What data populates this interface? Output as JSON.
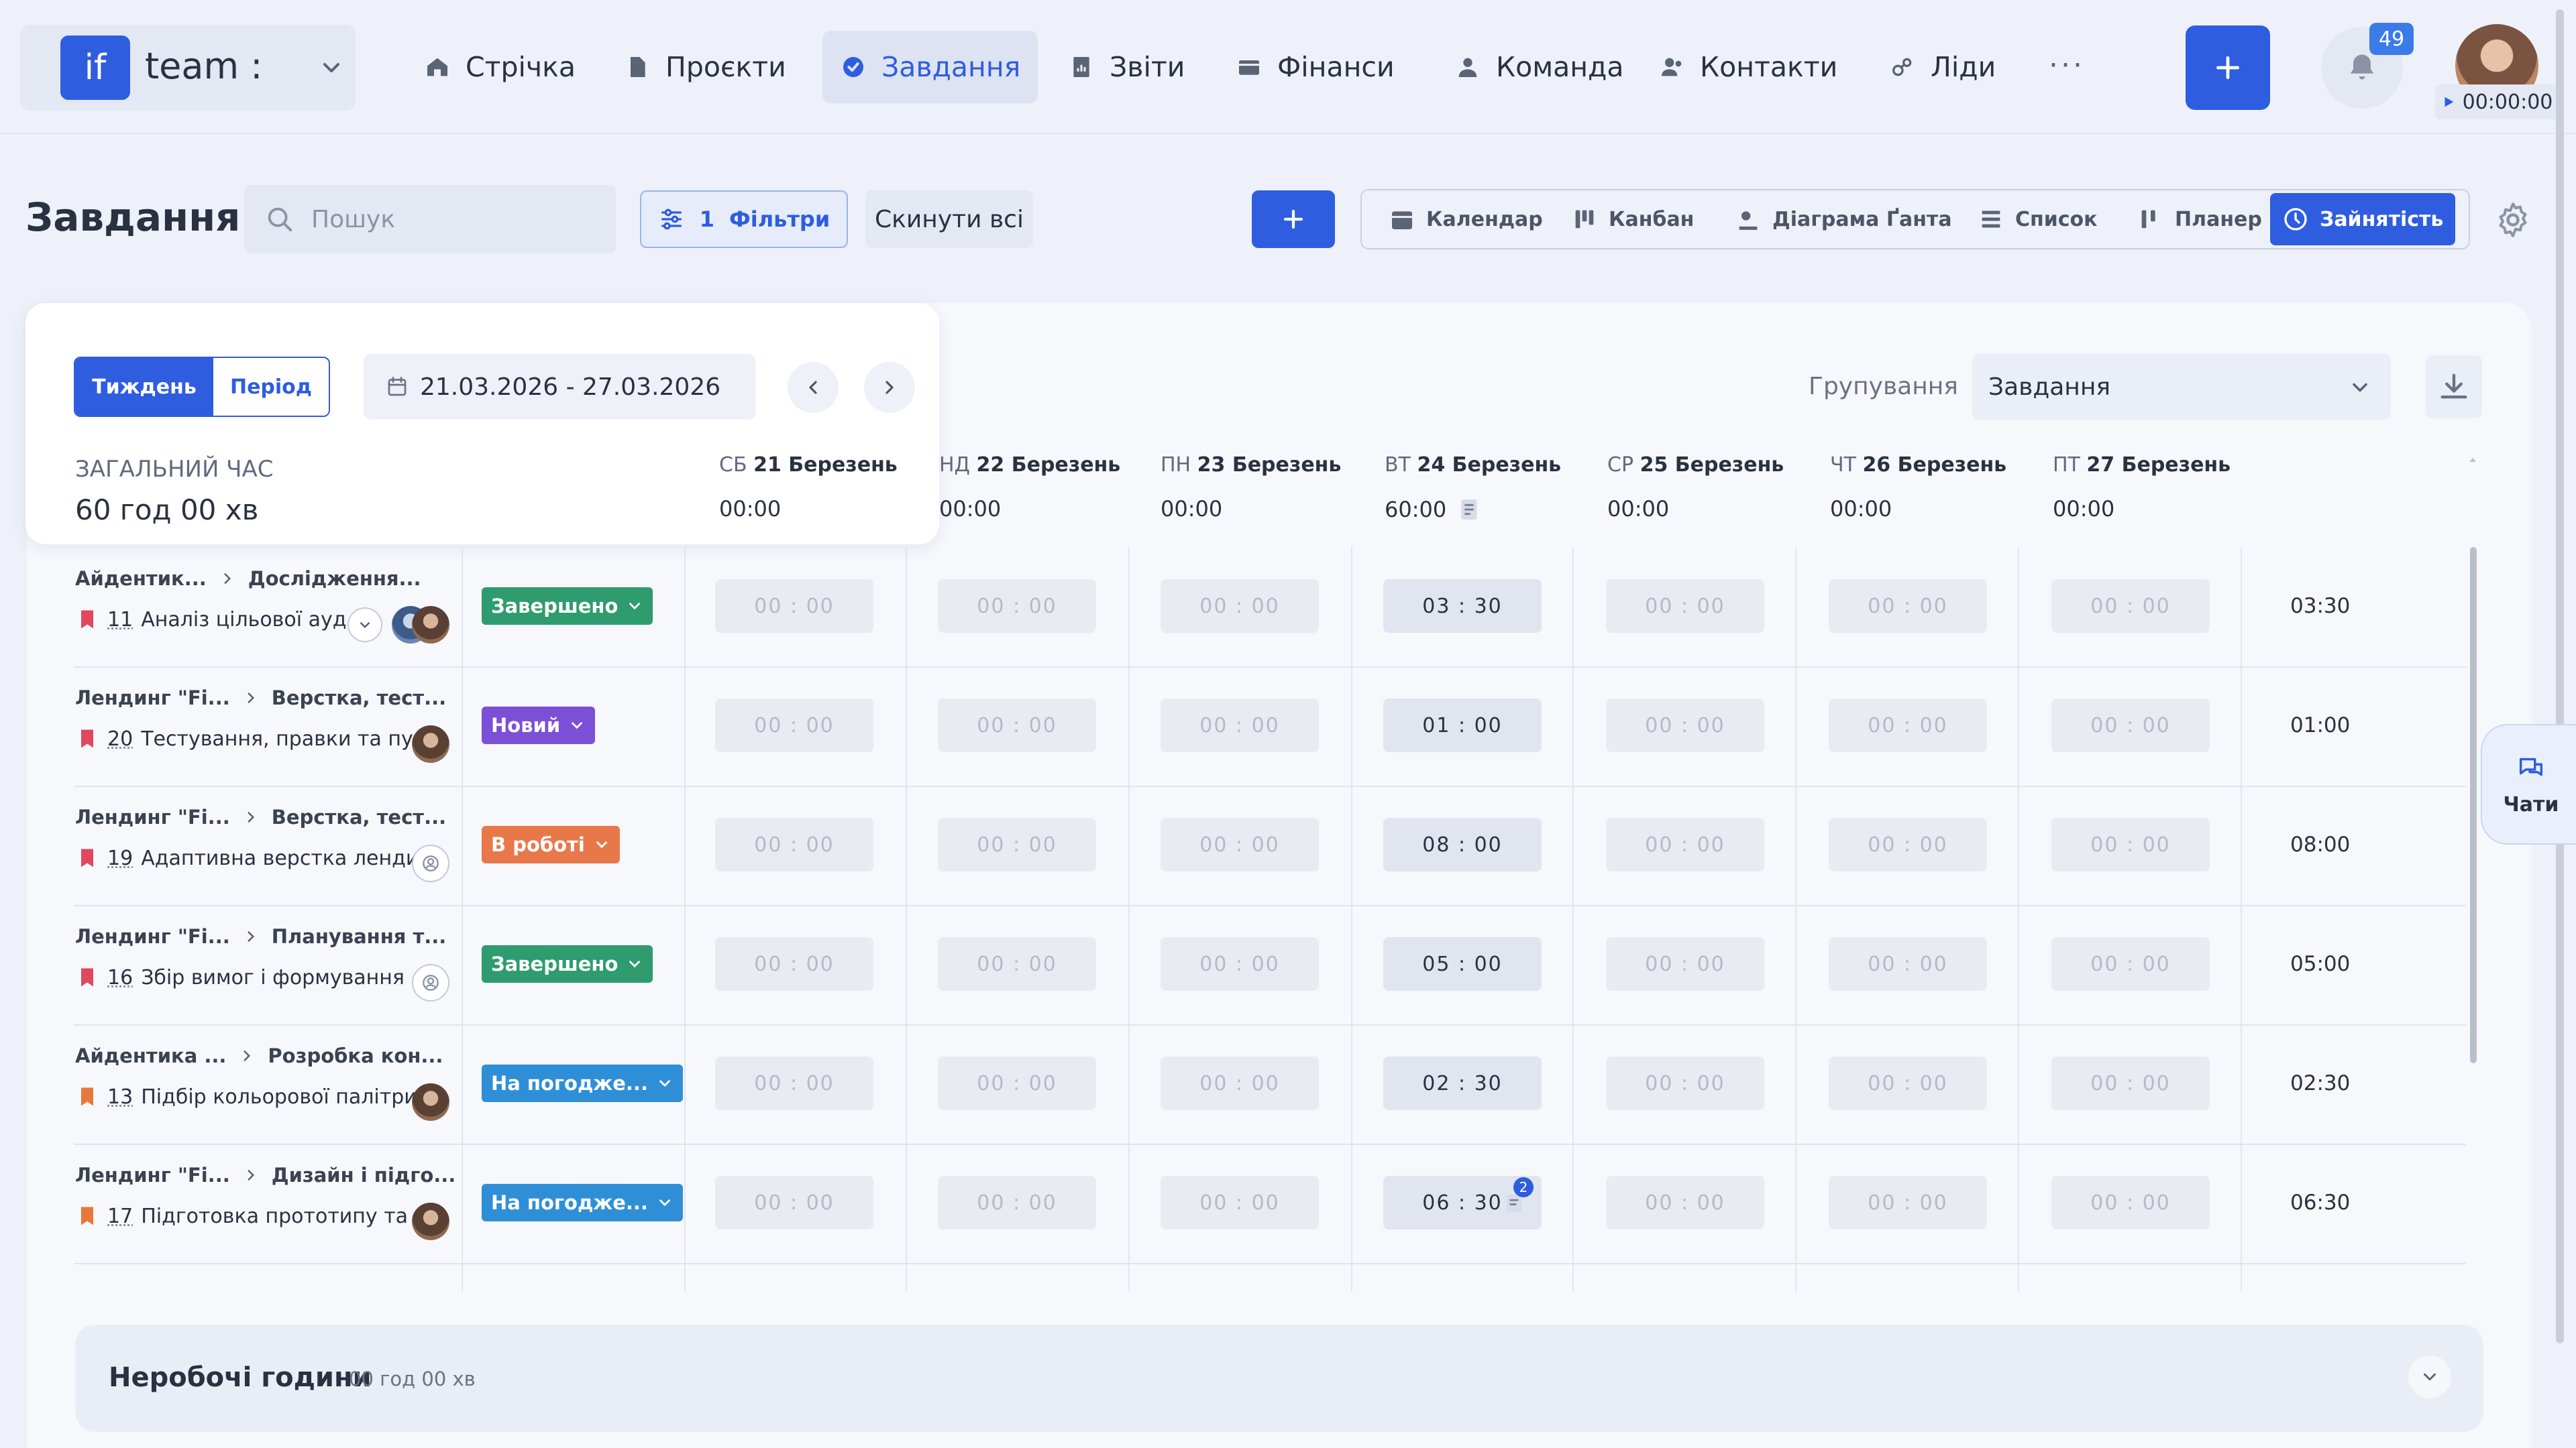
{
  "brand": {
    "logo": "if",
    "name": "team :"
  },
  "nav": [
    {
      "label": "Стрічка",
      "icon": "home-icon"
    },
    {
      "label": "Проєкти",
      "icon": "file-icon"
    },
    {
      "label": "Завдання",
      "icon": "check-circle-icon",
      "active": true
    },
    {
      "label": "Звіти",
      "icon": "chart-icon"
    },
    {
      "label": "Фінанси",
      "icon": "wallet-icon"
    },
    {
      "label": "Команда",
      "icon": "person-icon"
    },
    {
      "label": "Контакти",
      "icon": "contacts-icon"
    },
    {
      "label": "Ліди",
      "icon": "leads-icon"
    }
  ],
  "nav_more": "···",
  "notifications": {
    "count": "49"
  },
  "timer": {
    "value": "00:00:00"
  },
  "page": {
    "title": "Завдання"
  },
  "search": {
    "placeholder": "Пошук"
  },
  "filters": {
    "count": "1",
    "label": "Фільтри",
    "reset": "Скинути всі"
  },
  "views": [
    {
      "label": "Календар",
      "icon": "calendar-icon"
    },
    {
      "label": "Канбан",
      "icon": "kanban-icon"
    },
    {
      "label": "Діаграма Ґанта",
      "icon": "gantt-icon"
    },
    {
      "label": "Список",
      "icon": "list-icon"
    },
    {
      "label": "Планер",
      "icon": "planner-icon"
    },
    {
      "label": "Зайнятість",
      "icon": "clock-icon",
      "active": true
    }
  ],
  "period": {
    "week": "Тиждень",
    "period": "Період",
    "range": "21.03.2026 - 27.03.2026",
    "total_label": "ЗАГАЛЬНИЙ ЧАС",
    "total_value": "60 год 00 хв"
  },
  "grouping": {
    "label": "Групування",
    "value": "Завдання"
  },
  "days": [
    {
      "dow": "СБ",
      "date": "21 Березень",
      "total": "00:00"
    },
    {
      "dow": "НД",
      "date": "22 Березень",
      "total": "00:00"
    },
    {
      "dow": "ПН",
      "date": "23 Березень",
      "total": "00:00"
    },
    {
      "dow": "ВТ",
      "date": "24 Березень",
      "total": "60:00"
    },
    {
      "dow": "СР",
      "date": "25 Березень",
      "total": "00:00"
    },
    {
      "dow": "ЧТ",
      "date": "26 Березень",
      "total": "00:00"
    },
    {
      "dow": "ПТ",
      "date": "27 Березень",
      "total": "00:00"
    }
  ],
  "empty_time": "00 : 00",
  "tasks": [
    {
      "project": "Айдентик...",
      "section": "Дослідження...",
      "num": "11",
      "name": "Аналіз цільової ауд...",
      "status": "Завершено",
      "status_color": "#2e9c6e",
      "flag_color": "#e0485e",
      "day_value": "03 : 30",
      "total": "03:30",
      "assignee": "group"
    },
    {
      "project": "Лендинг \"Fi...",
      "section": "Верстка, тест...",
      "num": "20",
      "name": "Тестування, правки та пу...",
      "status": "Новий",
      "status_color": "#7b4fd6",
      "flag_color": "#e0485e",
      "day_value": "01 : 00",
      "total": "01:00",
      "assignee": "person"
    },
    {
      "project": "Лендинг \"Fi...",
      "section": "Верстка, тест...",
      "num": "19",
      "name": "Адаптивна верстка ленди...",
      "status": "В роботі",
      "status_color": "#e8784a",
      "flag_color": "#e0485e",
      "day_value": "08 : 00",
      "total": "08:00",
      "assignee": "empty"
    },
    {
      "project": "Лендинг \"Fi...",
      "section": "Планування т...",
      "num": "16",
      "name": "Збір вимог і формування ...",
      "status": "Завершено",
      "status_color": "#2e9c6e",
      "flag_color": "#e0485e",
      "day_value": "05 : 00",
      "total": "05:00",
      "assignee": "empty"
    },
    {
      "project": "Айдентика ...",
      "section": "Розробка кон...",
      "num": "13",
      "name": "Підбір кольорової палітри...",
      "status": "На погодже...",
      "status_color": "#2f8fd6",
      "flag_color": "#e8783a",
      "day_value": "02 : 30",
      "total": "02:30",
      "assignee": "person"
    },
    {
      "project": "Лендинг \"Fi...",
      "section": "Дизайн і підго...",
      "num": "17",
      "name": "Підготовка прототипу та ...",
      "status": "На погодже...",
      "status_color": "#2f8fd6",
      "flag_color": "#e8783a",
      "day_value": "06 : 30",
      "total": "06:30",
      "assignee": "person",
      "note_count": "2"
    }
  ],
  "chat": {
    "label": "Чати"
  },
  "nonwork": {
    "title": "Неробочі години",
    "hours": "00 год 00 хв"
  }
}
